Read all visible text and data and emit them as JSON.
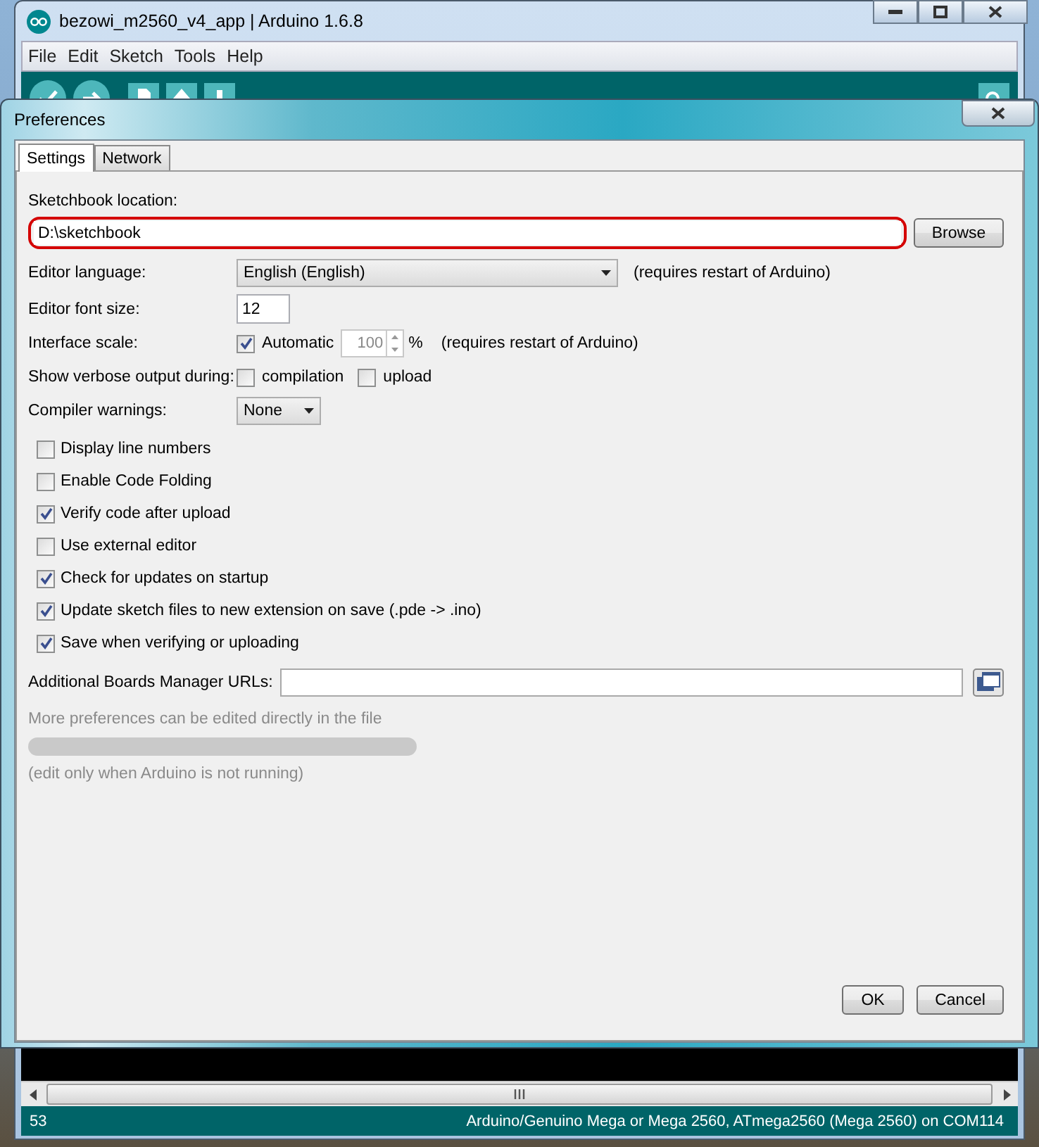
{
  "main_window": {
    "title": "bezowi_m2560_v4_app | Arduino 1.6.8",
    "menu": [
      "File",
      "Edit",
      "Sketch",
      "Tools",
      "Help"
    ],
    "status_bar": {
      "line": "53",
      "board": "Arduino/Genuino Mega or Mega 2560, ATmega2560 (Mega 2560) on COM114"
    }
  },
  "dialog": {
    "title": "Preferences",
    "tabs": [
      {
        "label": "Settings",
        "selected": true
      },
      {
        "label": "Network",
        "selected": false
      }
    ],
    "sketchbook": {
      "label": "Sketchbook location:",
      "value": "D:\\sketchbook",
      "circled": true,
      "button": "Browse"
    },
    "editor_language": {
      "label": "Editor language:",
      "value": "English (English)",
      "note": "(requires restart of Arduino)"
    },
    "font_size": {
      "label": "Editor font size:",
      "value": "12"
    },
    "interface_scale": {
      "label": "Interface scale:",
      "automatic": {
        "label": "Automatic",
        "checked": true
      },
      "value": "100",
      "disabled": true,
      "unit": "%",
      "note": "(requires restart of Arduino)"
    },
    "verbose": {
      "label": "Show verbose output during:",
      "options": [
        {
          "label": "compilation",
          "checked": false
        },
        {
          "label": "upload",
          "checked": false
        }
      ]
    },
    "compiler_warnings": {
      "label": "Compiler warnings:",
      "value": "None"
    },
    "options": [
      {
        "label": "Display line numbers",
        "checked": false
      },
      {
        "label": "Enable Code Folding",
        "checked": false
      },
      {
        "label": "Verify code after upload",
        "checked": true
      },
      {
        "label": "Use external editor",
        "checked": false
      },
      {
        "label": "Check for updates on startup",
        "checked": true
      },
      {
        "label": "Update sketch files to new extension on save (.pde -> .ino)",
        "checked": true
      },
      {
        "label": "Save when verifying or uploading",
        "checked": true
      }
    ],
    "boards_urls": {
      "label": "Additional Boards Manager URLs:"
    },
    "more_info": "More preferences can be edited directly in the file",
    "edit_note": "(edit only when Arduino is not running)",
    "buttons": [
      {
        "label": "OK"
      },
      {
        "label": "Cancel"
      }
    ]
  }
}
